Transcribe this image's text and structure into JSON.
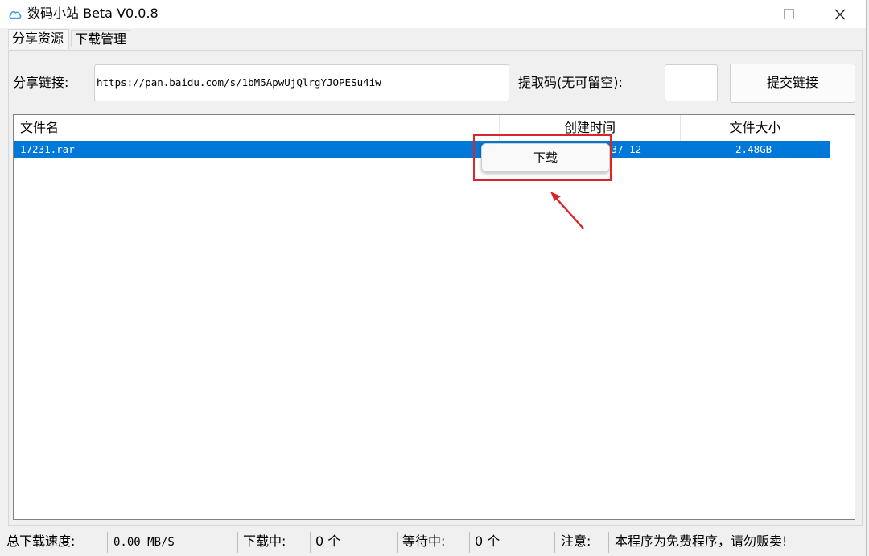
{
  "window": {
    "title": "数码小站 Beta V0.0.8",
    "accent": "#0078d7",
    "highlight": "#d9262b"
  },
  "tabs": [
    {
      "label": "分享资源",
      "active": true
    },
    {
      "label": "下载管理",
      "active": false
    }
  ],
  "share": {
    "link_label": "分享链接:",
    "link_value": "https://pan.baidu.com/s/1bM5ApwUjQlrgYJOPESu4iw",
    "code_label": "提取码(无可留空):",
    "code_value": "",
    "submit_label": "提交链接"
  },
  "file_list": {
    "columns": [
      "文件名",
      "创建时间",
      "文件大小"
    ],
    "rows": [
      {
        "name": "17231.rar",
        "created": "-37-12",
        "size": "2.48GB"
      }
    ]
  },
  "context_menu": {
    "items": [
      "下载"
    ]
  },
  "status": {
    "speed_label": "总下载速度:",
    "speed_value": "0.00 MB/S",
    "downloading_label": "下载中:",
    "downloading_value": "0 个",
    "waiting_label": "等待中:",
    "waiting_value": "0 个",
    "notice_label": "注意:",
    "notice_value": "本程序为免费程序，请勿贩卖!"
  }
}
